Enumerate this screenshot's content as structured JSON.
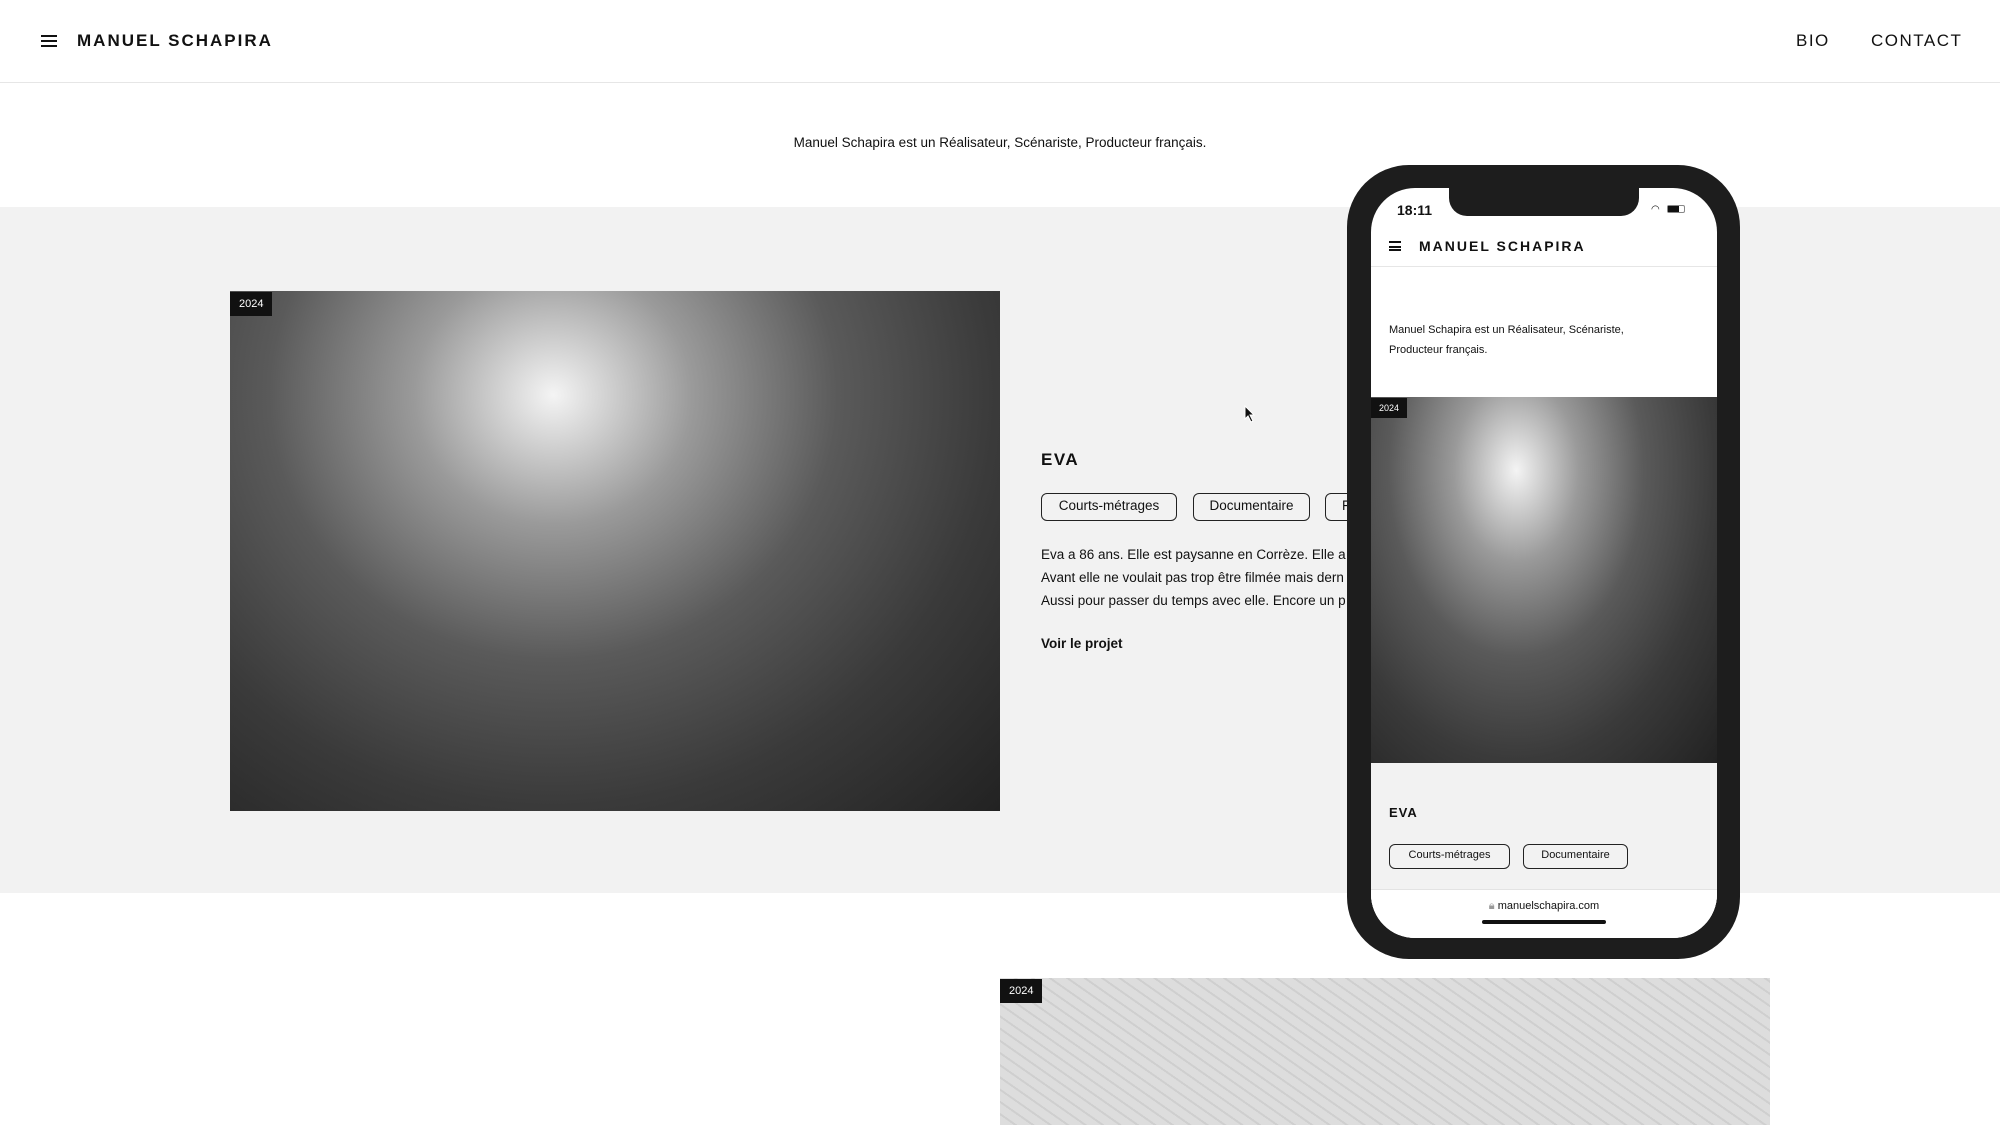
{
  "header": {
    "title": "MANUEL SCHAPIRA",
    "nav": [
      "BIO",
      "CONTACT"
    ]
  },
  "intro": "Manuel Schapira est un Réalisateur, Scénariste, Producteur français.",
  "project": {
    "year": "2024",
    "title": "EVA",
    "tags": [
      "Courts-métrages",
      "Documentaire",
      "F"
    ],
    "description": [
      "Eva a 86 ans. Elle est paysanne en Corrèze. Elle a",
      "Avant elle ne voulait pas trop être filmée mais dern",
      "Aussi pour passer du temps avec elle. Encore un p"
    ],
    "link": "Voir le projet"
  },
  "next_project": {
    "year": "2024"
  },
  "phone": {
    "time": "18:11",
    "title": "MANUEL SCHAPIRA",
    "intro": "Manuel Schapira est un Réalisateur, Scénariste, Producteur français.",
    "year": "2024",
    "project_title": "EVA",
    "tags": [
      "Courts-métrages",
      "Documentaire"
    ],
    "url": "manuelschapira.com"
  }
}
